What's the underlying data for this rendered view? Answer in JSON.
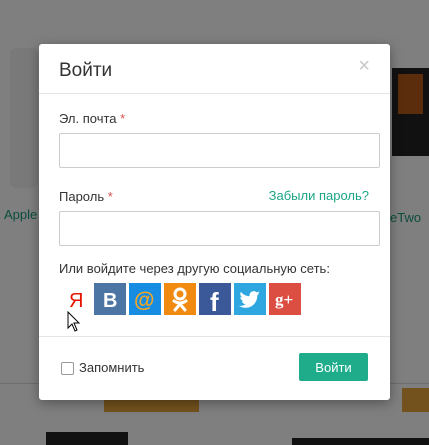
{
  "background": {
    "left_link_text": "Apple",
    "right_link_text": "eTwo"
  },
  "modal": {
    "title": "Войти",
    "close_symbol": "×",
    "email_label": "Эл. почта",
    "required_mark": "*",
    "email_value": "",
    "password_label": "Пароль",
    "password_value": "",
    "forgot_password": "Забыли пароль?",
    "social_prompt": "Или войдите через другую социальную сеть:",
    "social": [
      {
        "name": "yandex",
        "glyph": "Я",
        "color": "#e61400"
      },
      {
        "name": "vkontakte",
        "glyph": "В",
        "color": "#4c75a3"
      },
      {
        "name": "mail-ru",
        "glyph": "@",
        "color": "#168de2"
      },
      {
        "name": "odnoklassniki",
        "color": "#f18a10"
      },
      {
        "name": "facebook",
        "glyph": "f",
        "color": "#3b5998"
      },
      {
        "name": "twitter",
        "color": "#2ea7e0"
      },
      {
        "name": "google-plus",
        "glyph": "g+",
        "color": "#dc4e41"
      }
    ],
    "remember_label": "Запомнить",
    "remember_checked": false,
    "submit_label": "Войти"
  },
  "colors": {
    "accent": "#1eac8b",
    "link": "#1ba587",
    "required": "#d9534f"
  }
}
